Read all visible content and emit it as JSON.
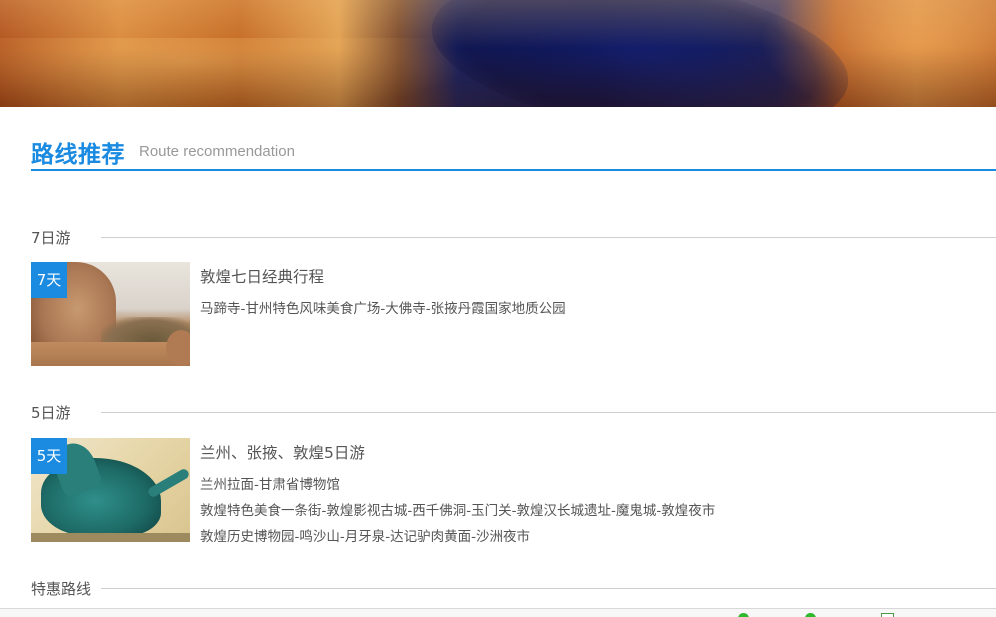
{
  "section": {
    "title": "路线推荐",
    "subtitle": "Route recommendation",
    "accent_color": "#1a8be0"
  },
  "groups": [
    {
      "title": "7日游",
      "routes": [
        {
          "badge": "7天",
          "title": "敦煌七日经典行程",
          "lines": [
            "马蹄寺-甘州特色风味美食广场-大佛寺-张掖丹霞国家地质公园"
          ]
        }
      ]
    },
    {
      "title": "5日游",
      "routes": [
        {
          "badge": "5天",
          "title": "兰州、张掖、敦煌5日游",
          "lines": [
            "兰州拉面-甘肃省博物馆",
            "敦煌特色美食一条街-敦煌影视古城-西千佛洞-玉门关-敦煌汉长城遗址-魔鬼城-敦煌夜市",
            "敦煌历史博物园-鸣沙山-月牙泉-达记驴肉黄面-沙洲夜市"
          ]
        }
      ]
    },
    {
      "title": "特惠路线",
      "routes": []
    }
  ]
}
